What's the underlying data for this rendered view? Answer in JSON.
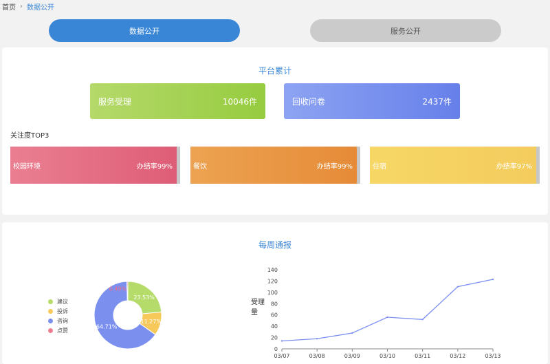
{
  "breadcrumb": {
    "home": "首页",
    "current": "数据公开"
  },
  "tabs": {
    "active": "数据公开",
    "inactive": "服务公开"
  },
  "platform": {
    "title": "平台累计",
    "stats": [
      {
        "label": "服务受理",
        "value": "10046件",
        "color": "#a6d254"
      },
      {
        "label": "回收问卷",
        "value": "2437件",
        "color": "#7993ee"
      }
    ]
  },
  "top3": {
    "label": "关注度TOP3",
    "items": [
      {
        "name": "校园环境",
        "rate": "办结率99%",
        "color": "#e46d84"
      },
      {
        "name": "餐饮",
        "rate": "办结率99%",
        "color": "#e99744"
      },
      {
        "name": "住宿",
        "rate": "办结率97%",
        "color": "#f5d261"
      }
    ]
  },
  "weekly": {
    "title": "每周通报",
    "legend": [
      "建议",
      "投诉",
      "咨询",
      "点赞"
    ]
  },
  "chart_data": [
    {
      "type": "pie",
      "categories": [
        "建议",
        "投诉",
        "咨询",
        "点赞"
      ],
      "values": [
        23.53,
        11.27,
        64.71,
        0.49
      ],
      "labels": [
        "23.53%",
        "11.27%",
        "64.71%",
        "0.49%"
      ],
      "colors": [
        "#b5dc6a",
        "#f7c95b",
        "#7b90ee",
        "#ee7f93"
      ]
    },
    {
      "type": "line",
      "x": [
        "03/07",
        "03/08",
        "03/09",
        "03/10",
        "03/11",
        "03/12",
        "03/13"
      ],
      "series": [
        {
          "values": [
            14,
            18,
            28,
            56,
            52,
            110,
            123
          ]
        }
      ],
      "ylabel": "受理量",
      "ylim": [
        0,
        140
      ],
      "yticks": [
        0,
        20,
        40,
        60,
        80,
        100,
        120,
        140
      ],
      "color": "#7b8ff0"
    }
  ]
}
